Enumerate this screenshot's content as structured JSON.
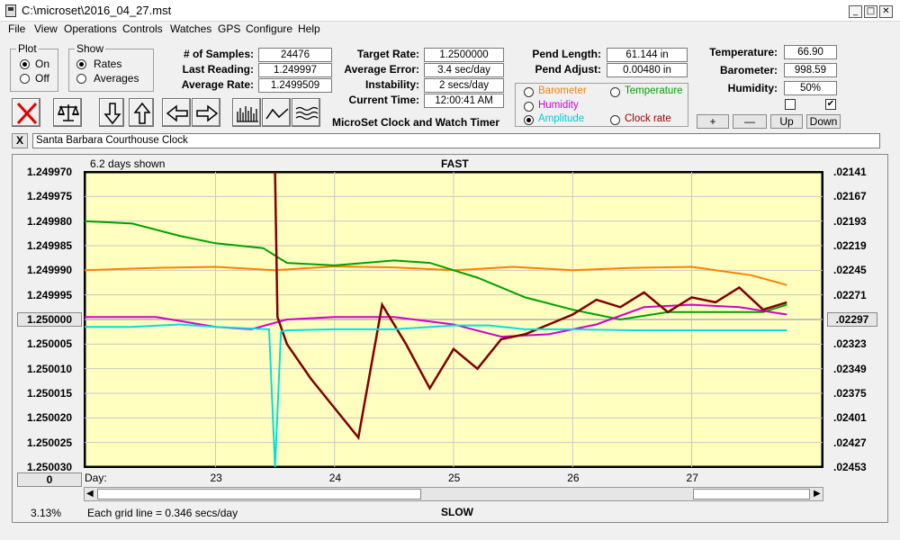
{
  "window": {
    "title": "C:\\microset\\2016_04_27.mst",
    "minimize": "_",
    "maximize": "□",
    "close": "✕"
  },
  "menu": [
    "File",
    "View",
    "Operations",
    "Controls",
    "Watches",
    "GPS",
    "Configure",
    "Help"
  ],
  "plot_group": {
    "title": "Plot",
    "options": [
      "On",
      "Off"
    ],
    "selected": "On"
  },
  "show_group": {
    "title": "Show",
    "options": [
      "Rates",
      "Averages"
    ],
    "selected": "Rates"
  },
  "stats": {
    "samples_label": "# of Samples:",
    "samples": "24476",
    "last_reading_label": "Last Reading:",
    "last_reading": "1.249997",
    "average_rate_label": "Average Rate:",
    "average_rate": "1.2499509",
    "target_rate_label": "Target Rate:",
    "target_rate": "1.2500000",
    "average_error_label": "Average Error:",
    "average_error": "3.4 sec/day",
    "instability_label": "Instability:",
    "instability": "2 secs/day",
    "current_time_label": "Current Time:",
    "current_time": "12:00:41 AM",
    "app_name": "MicroSet Clock and Watch Timer",
    "pend_length_label": "Pend Length:",
    "pend_length": "61.144 in",
    "pend_adjust_label": "Pend Adjust:",
    "pend_adjust": "0.00480 in"
  },
  "sensors": {
    "temperature_label": "Temperature:",
    "temperature": "66.90",
    "barometer_label": "Barometer:",
    "barometer": "998.59",
    "humidity_label": "Humidity:",
    "humidity": "50%",
    "checkbox_1": false,
    "checkbox_2": true
  },
  "series_selector": {
    "options": [
      {
        "label": "Barometer",
        "color": "#ff8000"
      },
      {
        "label": "Temperature",
        "color": "#00a000"
      },
      {
        "label": "Humidity",
        "color": "#d000d0"
      },
      {
        "label": "Clock rate",
        "color": "#a00000"
      },
      {
        "label": "Amplitude",
        "color": "#00c8d8"
      }
    ],
    "selected": "Amplitude"
  },
  "adjust_buttons": {
    "plus": "+",
    "minus": "—",
    "up": "Up",
    "down": "Down"
  },
  "clock_name": "Santa Barbara Courthouse Clock",
  "clock_close": "X",
  "chart_header": {
    "days_shown": "6.2 days shown",
    "fast": "FAST",
    "slow": "SLOW"
  },
  "left_center_button": "1.250000",
  "right_center_button": ".02297",
  "zero_button": "0",
  "footer": {
    "percent": "3.13%",
    "grid_note": "Each grid line = 0.346 secs/day"
  },
  "chart_data": {
    "type": "line",
    "title": "",
    "xlabel": "Day:",
    "x_ticks": [
      "23",
      "24",
      "25",
      "26",
      "27"
    ],
    "y_left_ticks": [
      "1.249970",
      "1.249975",
      "1.249980",
      "1.249985",
      "1.249990",
      "1.249995",
      "1.250000",
      "1.250005",
      "1.250010",
      "1.250015",
      "1.250020",
      "1.250025",
      "1.250030"
    ],
    "y_right_ticks": [
      ".02141",
      ".02167",
      ".02193",
      ".02219",
      ".02245",
      ".02271",
      ".02297",
      ".02323",
      ".02349",
      ".02375",
      ".02401",
      ".02427",
      ".02453"
    ],
    "ylim_left": [
      1.25003,
      1.24997
    ],
    "xlim_days": [
      21.9,
      28.1
    ],
    "grid": true,
    "series": [
      {
        "name": "Barometer",
        "color": "#ff8000",
        "x": [
          21.9,
          22.5,
          23.0,
          23.5,
          24.0,
          24.5,
          25.0,
          25.5,
          26.0,
          26.5,
          27.0,
          27.5,
          27.8
        ],
        "y": [
          1.24999,
          1.2499895,
          1.2499893,
          1.24999,
          1.2499892,
          1.2499894,
          1.24999,
          1.2499893,
          1.24999,
          1.2499895,
          1.2499893,
          1.249991,
          1.249993
        ]
      },
      {
        "name": "Temperature",
        "color": "#00a000",
        "x": [
          21.9,
          22.3,
          22.7,
          23.0,
          23.4,
          23.6,
          24.0,
          24.5,
          24.8,
          25.2,
          25.6,
          26.0,
          26.4,
          26.8,
          27.2,
          27.6,
          27.8
        ],
        "y": [
          1.24998,
          1.2499805,
          1.249983,
          1.2499845,
          1.2499855,
          1.2499885,
          1.249989,
          1.249988,
          1.2499885,
          1.2499915,
          1.2499955,
          1.249998,
          1.25,
          1.2499985,
          1.2499985,
          1.2499985,
          1.249997
        ]
      },
      {
        "name": "Humidity",
        "color": "#d000d0",
        "x": [
          21.9,
          22.5,
          23.0,
          23.3,
          23.6,
          24.0,
          24.5,
          25.0,
          25.4,
          25.8,
          26.2,
          26.6,
          27.0,
          27.4,
          27.8
        ],
        "y": [
          1.2499995,
          1.2499995,
          1.2500015,
          1.250002,
          1.25,
          1.2499995,
          1.2499995,
          1.250001,
          1.2500035,
          1.250003,
          1.250001,
          1.2499975,
          1.249997,
          1.2499975,
          1.249999
        ]
      },
      {
        "name": "Clock rate",
        "color": "#800000",
        "x": [
          23.5,
          23.52,
          23.6,
          23.8,
          24.0,
          24.2,
          24.4,
          24.6,
          24.8,
          25.0,
          25.2,
          25.4,
          25.6,
          25.8,
          26.0,
          26.2,
          26.4,
          26.6,
          26.8,
          27.0,
          27.2,
          27.4,
          27.6,
          27.8
        ],
        "y": [
          1.24997,
          1.2499995,
          1.250005,
          1.250012,
          1.250018,
          1.250024,
          1.249997,
          1.250005,
          1.250014,
          1.250006,
          1.25001,
          1.250004,
          1.250003,
          1.250001,
          1.249999,
          1.249996,
          1.2499975,
          1.2499945,
          1.2499985,
          1.2499955,
          1.2499965,
          1.2499935,
          1.249998,
          1.2499965
        ]
      },
      {
        "name": "Amplitude",
        "color": "#00e0e0",
        "x": [
          21.9,
          22.3,
          22.7,
          23.0,
          23.45,
          23.5,
          23.55,
          23.6,
          24.0,
          24.5,
          25.0,
          25.3,
          25.6,
          26.0,
          26.5,
          27.0,
          27.5,
          27.8
        ],
        "y": [
          1.2500015,
          1.2500015,
          1.250001,
          1.2500015,
          1.250002,
          1.25003,
          1.2500025,
          1.2500022,
          1.250002,
          1.250002,
          1.2500012,
          1.2500012,
          1.250002,
          1.250002,
          1.2500022,
          1.2500022,
          1.2500022,
          1.2500022
        ]
      }
    ]
  }
}
